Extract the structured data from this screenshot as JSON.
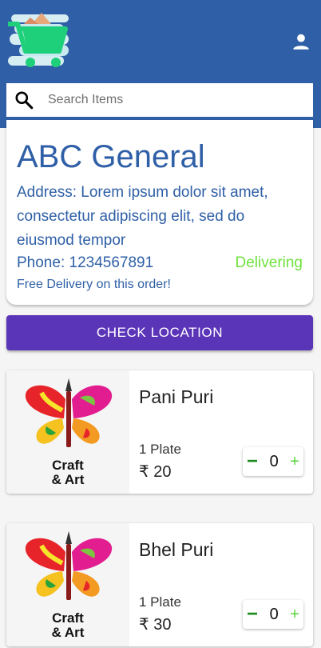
{
  "search": {
    "placeholder": "Search Items",
    "value": ""
  },
  "store": {
    "name": "ABC General",
    "address": "Address: Lorem ipsum dolor sit amet, consectetur adipiscing elit, sed do eiusmod tempor",
    "phone": "Phone: 1234567891",
    "status": "Delivering",
    "note": "Free Delivery on this order!"
  },
  "check_location_label": "CHECK LOCATION",
  "product_image": {
    "line1": "Craft",
    "line2": "& Art"
  },
  "products": [
    {
      "name": "Pani Puri",
      "unit": "1 Plate",
      "price": "₹ 20",
      "qty": "0",
      "minus": "−",
      "plus": "+"
    },
    {
      "name": "Bhel Puri",
      "unit": "1 Plate",
      "price": "₹ 30",
      "qty": "0",
      "minus": "−",
      "plus": "+"
    }
  ],
  "colors": {
    "header": "#2f5fa6",
    "button": "#5b35b8",
    "status": "#6fe33c",
    "cart": "#1fd07a"
  },
  "icons": {
    "logo": "shopping-cart-icon",
    "user": "person-icon",
    "search": "search-icon"
  }
}
